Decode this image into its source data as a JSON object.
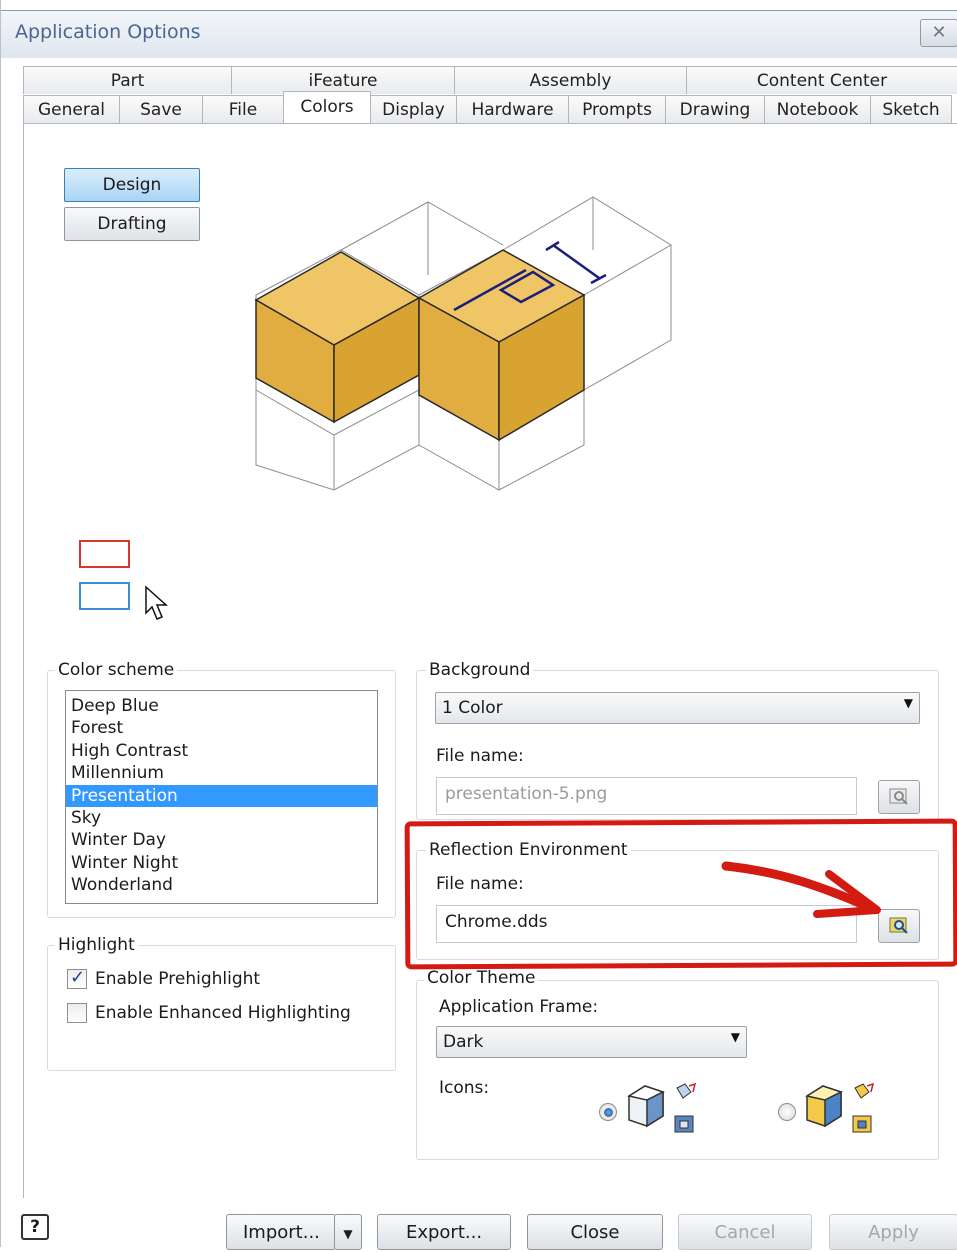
{
  "window": {
    "title": "Application Options",
    "close_icon": "close-x-icon"
  },
  "tabs_top": [
    "Part",
    "iFeature",
    "Assembly",
    "Content Center"
  ],
  "tabs_bottom": [
    "General",
    "Save",
    "File",
    "Colors",
    "Display",
    "Hardware",
    "Prompts",
    "Drawing",
    "Notebook",
    "Sketch"
  ],
  "active_tab": "Colors",
  "mode_buttons": {
    "design": "Design",
    "drafting": "Drafting",
    "selected": "Design"
  },
  "preview": {
    "part_color": "#e8b449",
    "highlight_swatch_color": "#d9372d",
    "select_swatch_color": "#3a8fd6"
  },
  "color_scheme": {
    "label": "Color scheme",
    "items": [
      "Deep Blue",
      "Forest",
      "High Contrast",
      "Millennium",
      "Presentation",
      "Sky",
      "Winter Day",
      "Winter Night",
      "Wonderland"
    ],
    "selected": "Presentation"
  },
  "highlight": {
    "label": "Highlight",
    "prehighlight": {
      "label": "Enable Prehighlight",
      "checked": true
    },
    "enhanced": {
      "label": "Enable Enhanced Highlighting",
      "checked": false
    }
  },
  "background": {
    "label": "Background",
    "mode": "1 Color",
    "file_label": "File name:",
    "file_value": "presentation-5.png"
  },
  "reflection": {
    "label": "Reflection Environment",
    "file_label": "File name:",
    "file_value": "Chrome.dds"
  },
  "color_theme": {
    "label": "Color Theme",
    "frame_label": "Application Frame:",
    "frame_value": "Dark",
    "icons_label": "Icons:",
    "selected_icon_style": "classic"
  },
  "buttons": {
    "import": "Import...",
    "export": "Export...",
    "close": "Close",
    "cancel": "Cancel",
    "apply": "Apply",
    "help": "?"
  },
  "annotation_color": "#d41b12"
}
